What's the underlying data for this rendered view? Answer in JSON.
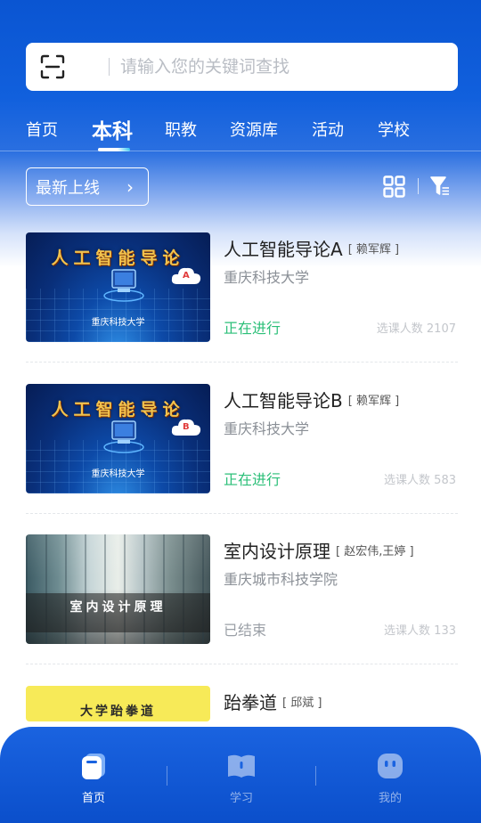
{
  "search": {
    "placeholder": "请输入您的关键词查找",
    "scan_icon": "scan-icon"
  },
  "tabs": [
    {
      "label": "首页",
      "active": false
    },
    {
      "label": "本科",
      "active": true
    },
    {
      "label": "职教",
      "active": false
    },
    {
      "label": "资源库",
      "active": false
    },
    {
      "label": "活动",
      "active": false
    },
    {
      "label": "学校",
      "active": false
    }
  ],
  "filter": {
    "label": "最新上线",
    "chevron": "›",
    "grid_icon": "grid-view-icon",
    "funnel_icon": "filter-funnel-icon"
  },
  "courses": [
    {
      "title": "人工智能导论A",
      "teacher": "[ 赖军辉 ]",
      "school": "重庆科技大学",
      "status": "正在进行",
      "count_text": "选课人数 2107",
      "thumb": {
        "title": "人工智能导论",
        "subtitle": "重庆科技大学",
        "badge": "A"
      }
    },
    {
      "title": "人工智能导论B",
      "teacher": "[ 赖军辉 ]",
      "school": "重庆科技大学",
      "status": "正在进行",
      "count_text": "选课人数 583",
      "thumb": {
        "title": "人工智能导论",
        "subtitle": "重庆科技大学",
        "badge": "B"
      }
    },
    {
      "title": "室内设计原理",
      "teacher": "[ 赵宏伟,王婷 ]",
      "school": "重庆城市科技学院",
      "status": "已结束",
      "count_text": "选课人数 133",
      "thumb": {
        "title": "室内设计原理"
      }
    },
    {
      "title": "跆拳道",
      "teacher": "[ 邱斌 ]",
      "thumb": {
        "title": "大学跆拳道"
      }
    }
  ],
  "colors": {
    "brand_blue": "#0a55d2",
    "status_ongoing": "#2bbf78",
    "status_ended": "#9a9fa6"
  },
  "bottom_nav": [
    {
      "label": "首页",
      "icon": "home-icon",
      "active": true
    },
    {
      "label": "学习",
      "icon": "book-icon",
      "active": false
    },
    {
      "label": "我的",
      "icon": "profile-face-icon",
      "active": false
    }
  ]
}
